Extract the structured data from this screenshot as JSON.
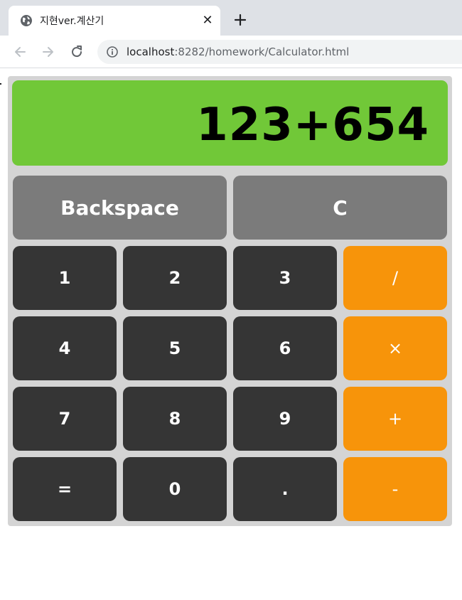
{
  "browser": {
    "tab_title": "지현ver.계산기",
    "close_glyph": "✕",
    "url_host": "localhost",
    "url_rest": ":8282/homework/Calculator.html"
  },
  "calculator": {
    "display": "123+654",
    "display_color": "#71c838",
    "function_keys": [
      "Backspace",
      "C"
    ],
    "rows": [
      [
        "1",
        "2",
        "3",
        "/"
      ],
      [
        "4",
        "5",
        "6",
        "×"
      ],
      [
        "7",
        "8",
        "9",
        "+"
      ],
      [
        "=",
        "0",
        ".",
        "-"
      ]
    ],
    "colors": {
      "function_key": "#7b7b7b",
      "number_key": "#353535",
      "operator_key": "#f7940a",
      "body": "#d4d4d4"
    }
  }
}
